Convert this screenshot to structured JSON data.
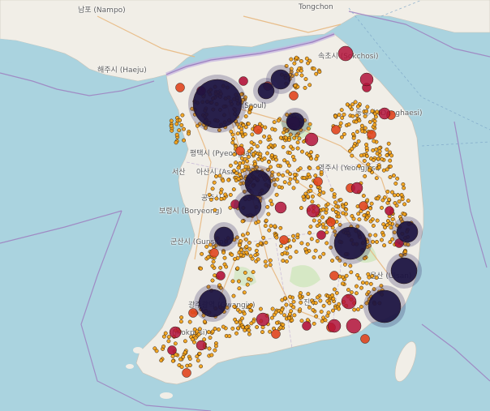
{
  "map": {
    "basemap": "OpenStreetMap",
    "colors": {
      "sea": "#aad3df",
      "land": "#f1eee7",
      "boundary": "#9e7fc0",
      "dmz": "#c4b3df",
      "road": "#e8b880",
      "park": "#cfe6bd",
      "dot_small": "#f2a31b",
      "dot_mid": "#e0451f",
      "dot_large": "#b1123a",
      "dot_huge": "#1b1240"
    },
    "labels": [
      {
        "id": "nampo",
        "text": "남포 (Nampo)"
      },
      {
        "id": "tongchon",
        "text": "Tongchon"
      },
      {
        "id": "haeju",
        "text": "해주시 (Haeju)"
      },
      {
        "id": "sokcho",
        "text": "속초시 (Sokchosi)"
      },
      {
        "id": "seoul",
        "text": "(Seoul)"
      },
      {
        "id": "donghae",
        "text": "동해시 (Donghaesi)"
      },
      {
        "id": "pyeongtaek",
        "text": "평택시 (Pyeongtaek)"
      },
      {
        "id": "seosan",
        "text": "서산"
      },
      {
        "id": "asan",
        "text": "아산시 (Asan)"
      },
      {
        "id": "yeongju",
        "text": "영주시 (Yeongjusi)"
      },
      {
        "id": "gongju",
        "text": "공주시"
      },
      {
        "id": "boryeong",
        "text": "보령시 (Boryeong)"
      },
      {
        "id": "gunsan",
        "text": "군산시 (Gunsan)"
      },
      {
        "id": "ulsan",
        "text": "울산 (Ulsan)"
      },
      {
        "id": "gwangju",
        "text": "광주광역 (Gwangju)"
      },
      {
        "id": "jinju",
        "text": "진주"
      },
      {
        "id": "mokpo",
        "text": "(Mokposi)"
      }
    ]
  }
}
